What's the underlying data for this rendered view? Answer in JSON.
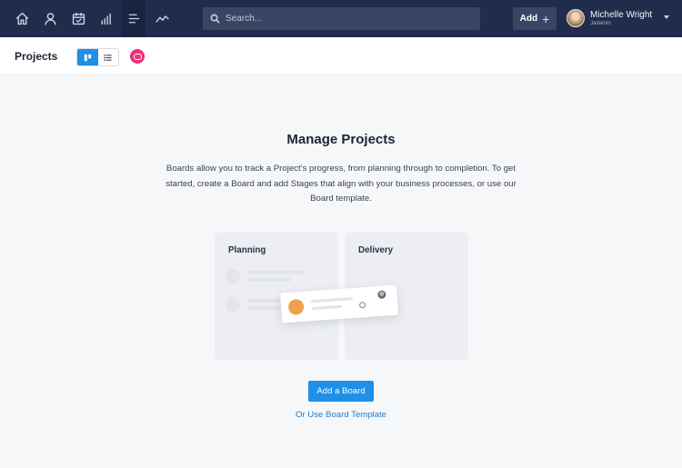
{
  "nav": {
    "icons": [
      "home-icon",
      "person-icon",
      "calendar-icon",
      "signal-bars-icon",
      "list-align-icon",
      "trend-line-icon"
    ],
    "search_placeholder": "Search...",
    "add_label": "Add",
    "add_icon": "plus-icon",
    "user_name": "Michelle Wright",
    "user_subtitle": "Jadamin"
  },
  "subheader": {
    "title": "Projects",
    "view_options": [
      "board-view-icon",
      "list-view-icon"
    ],
    "active_view": "board",
    "help_icon": "chat-bubble-icon"
  },
  "main": {
    "title": "Manage Projects",
    "description": "Boards allow you to track a Project’s progress, from planning through to completion. To get started, create a Board and add Stages that align with your business processes, or use our Board template.",
    "illustration": {
      "column_1": "Planning",
      "column_2": "Delivery"
    },
    "primary_button": "Add a Board",
    "secondary_link": "Or Use Board Template"
  },
  "colors": {
    "nav_bg": "#212c4d",
    "accent": "#1e90e8",
    "help_pink": "#e8317a",
    "card_dot": "#eca14a"
  }
}
